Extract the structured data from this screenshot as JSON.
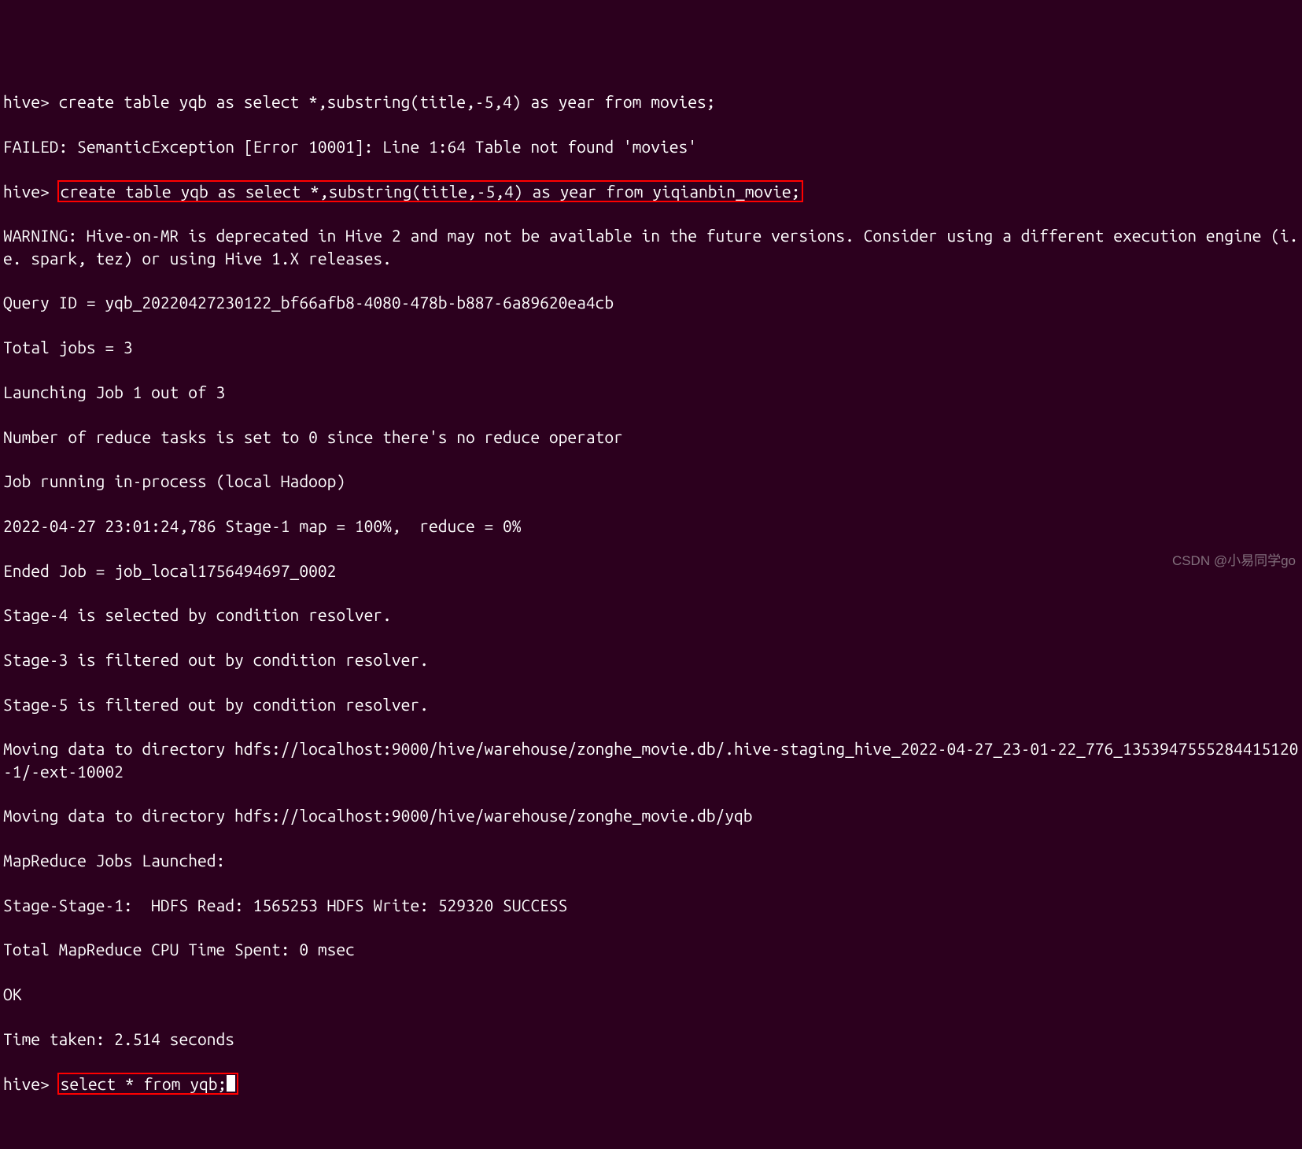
{
  "lines": {
    "l1_prompt": "hive> ",
    "l1_cmd": "create table yqb as select *,substring(title,-5,4) as year from movies;",
    "l2": "FAILED: SemanticException [Error 10001]: Line 1:64 Table not found 'movies'",
    "l3_prompt": "hive> ",
    "l3_cmd": "create table yqb as select *,substring(title,-5,4) as year from yiqianbin_movie;",
    "l4": "WARNING: Hive-on-MR is deprecated in Hive 2 and may not be available in the future versions. Consider using a different execution engine (i.e. spark, tez) or using Hive 1.X releases.",
    "l5": "Query ID = yqb_20220427230122_bf66afb8-4080-478b-b887-6a89620ea4cb",
    "l6": "Total jobs = 3",
    "l7": "Launching Job 1 out of 3",
    "l8": "Number of reduce tasks is set to 0 since there's no reduce operator",
    "l9": "Job running in-process (local Hadoop)",
    "l10": "2022-04-27 23:01:24,786 Stage-1 map = 100%,  reduce = 0%",
    "l11": "Ended Job = job_local1756494697_0002",
    "l12": "Stage-4 is selected by condition resolver.",
    "l13": "Stage-3 is filtered out by condition resolver.",
    "l14": "Stage-5 is filtered out by condition resolver.",
    "l15": "Moving data to directory hdfs://localhost:9000/hive/warehouse/zonghe_movie.db/.hive-staging_hive_2022-04-27_23-01-22_776_1353947555284415120-1/-ext-10002",
    "l16": "Moving data to directory hdfs://localhost:9000/hive/warehouse/zonghe_movie.db/yqb",
    "l17": "MapReduce Jobs Launched:",
    "l18": "Stage-Stage-1:  HDFS Read: 1565253 HDFS Write: 529320 SUCCESS",
    "l19": "Total MapReduce CPU Time Spent: 0 msec",
    "l20": "OK",
    "l21": "Time taken: 2.514 seconds",
    "l22_prompt": "hive> ",
    "l22_cmd": "select * from yqb;"
  },
  "watermark": "CSDN @小易同学go"
}
